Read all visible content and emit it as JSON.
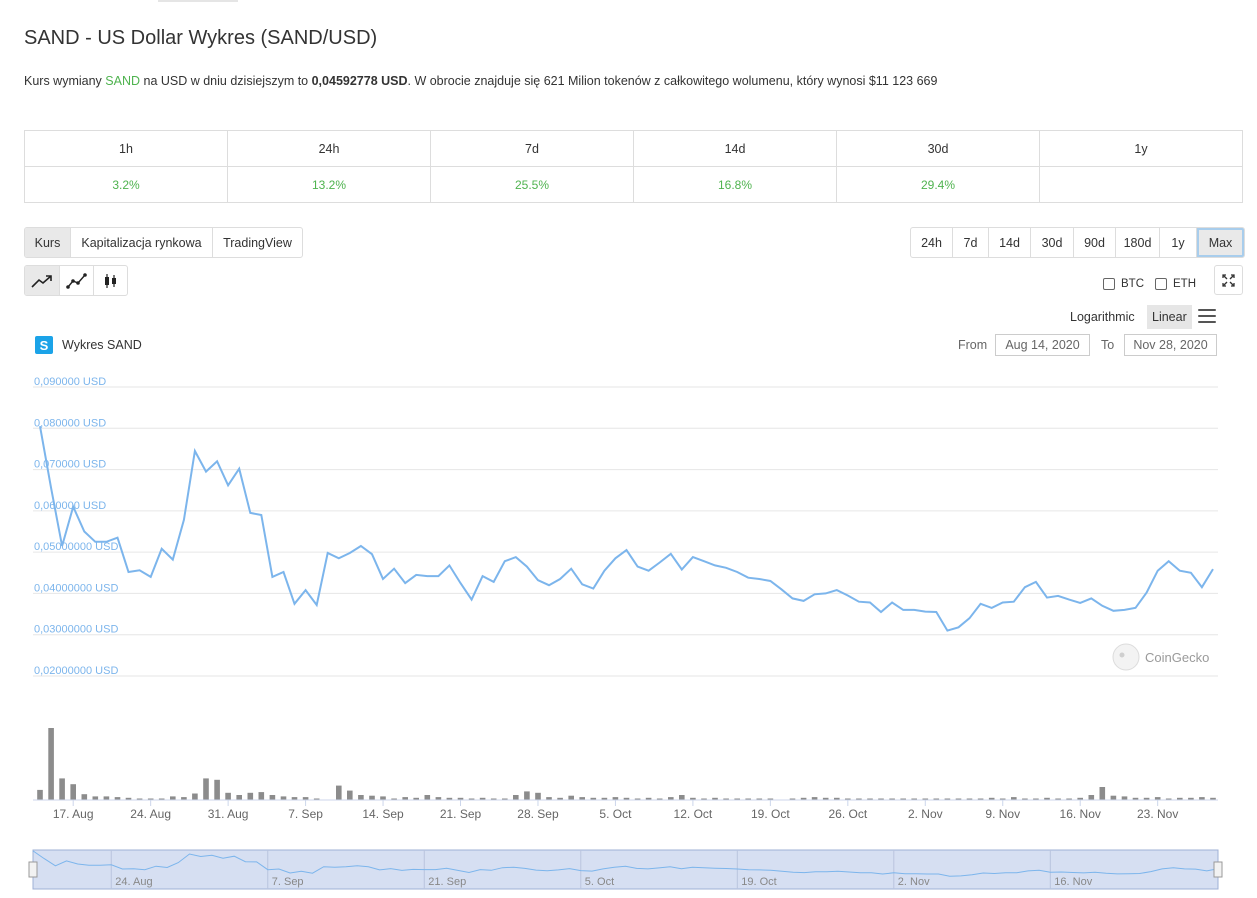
{
  "page": {
    "title": "SAND - US Dollar Wykres (SAND/USD)",
    "desc_pre": "Kurs wymiany ",
    "desc_coin": "SAND",
    "desc_mid": " na USD w dniu dzisiejszym to ",
    "desc_price": "0,04592778 USD",
    "desc_post": ". W obrocie znajduje się 621 Milion tokenów z całkowitego wolumenu, który wynosi $11 123 669"
  },
  "performance": {
    "headers": [
      "1h",
      "24h",
      "7d",
      "14d",
      "30d",
      "1y"
    ],
    "values": [
      "3.2%",
      "13.2%",
      "25.5%",
      "16.8%",
      "29.4%",
      ""
    ]
  },
  "tabs": [
    "Kurs",
    "Kapitalizacja rynkowa",
    "TradingView"
  ],
  "ranges": [
    "24h",
    "7d",
    "14d",
    "30d",
    "90d",
    "180d",
    "1y",
    "Max"
  ],
  "compare": {
    "btc": "BTC",
    "eth": "ETH"
  },
  "scale": {
    "log": "Logarithmic",
    "linear": "Linear"
  },
  "chart_label": "Wykres SAND",
  "logo_letter": "S",
  "range_from_label": "From",
  "range_from": "Aug 14, 2020",
  "range_to_label": "To",
  "range_to": "Nov 28, 2020",
  "watermark": "CoinGecko",
  "colors": {
    "line": "#7cb5ec",
    "volume": "#8c8c8c",
    "green": "#4fb34f",
    "navigator": "#d6dff2"
  },
  "chart_data": {
    "type": "line",
    "title": "",
    "ylabel": "",
    "ylim": [
      0.02,
      0.09
    ],
    "yticks": [
      0.02,
      0.03,
      0.04,
      0.05,
      0.06,
      0.07,
      0.08,
      0.09
    ],
    "ytick_labels": [
      "0,02000000 USD",
      "0,03000000 USD",
      "0,04000000 USD",
      "0,05000000 USD",
      "0,060000 USD",
      "0,070000 USD",
      "0,080000 USD",
      "0,090000 USD"
    ],
    "x_start": "2020-08-14",
    "x_end": "2020-11-28",
    "xtick_dates": [
      "2020-08-17",
      "2020-08-24",
      "2020-08-31",
      "2020-09-07",
      "2020-09-14",
      "2020-09-21",
      "2020-09-28",
      "2020-10-05",
      "2020-10-12",
      "2020-10-19",
      "2020-10-26",
      "2020-11-02",
      "2020-11-09",
      "2020-11-16",
      "2020-11-23"
    ],
    "xtick_labels": [
      "17. Aug",
      "24. Aug",
      "31. Aug",
      "7. Sep",
      "14. Sep",
      "21. Sep",
      "28. Sep",
      "5. Oct",
      "12. Oct",
      "19. Oct",
      "26. Oct",
      "2. Nov",
      "9. Nov",
      "16. Nov",
      "23. Nov"
    ],
    "navigator_labels": [
      "24. Aug",
      "7. Sep",
      "21. Sep",
      "5. Oct",
      "19. Oct",
      "2. Nov",
      "16. Nov"
    ],
    "navigator_dates": [
      "2020-08-24",
      "2020-09-07",
      "2020-09-21",
      "2020-10-05",
      "2020-10-19",
      "2020-11-02",
      "2020-11-16"
    ],
    "series": [
      {
        "values": [
          0.0805,
          0.0655,
          0.0515,
          0.061,
          0.055,
          0.0525,
          0.0525,
          0.0535,
          0.0452,
          0.0456,
          0.044,
          0.0508,
          0.0482,
          0.0578,
          0.0745,
          0.0695,
          0.072,
          0.0662,
          0.0702,
          0.0595,
          0.059,
          0.044,
          0.0452,
          0.0375,
          0.0408,
          0.0372,
          0.0498,
          0.0485,
          0.0498,
          0.0515,
          0.0495,
          0.0435,
          0.046,
          0.0425,
          0.0445,
          0.0442,
          0.0442,
          0.0468,
          0.0425,
          0.0385,
          0.0442,
          0.0428,
          0.0478,
          0.0488,
          0.0465,
          0.0432,
          0.042,
          0.0435,
          0.046,
          0.0422,
          0.0412,
          0.0455,
          0.0485,
          0.0505,
          0.0465,
          0.0455,
          0.0475,
          0.0496,
          0.0458,
          0.0488,
          0.0478,
          0.0468,
          0.0462,
          0.0452,
          0.0438,
          0.0435,
          0.043,
          0.041,
          0.0388,
          0.0382,
          0.0398,
          0.04,
          0.0408,
          0.0395,
          0.038,
          0.0378,
          0.0355,
          0.0378,
          0.036,
          0.036,
          0.0356,
          0.0355,
          0.031,
          0.0318,
          0.034,
          0.0375,
          0.0365,
          0.0378,
          0.038,
          0.0415,
          0.0428,
          0.039,
          0.0394,
          0.0385,
          0.0377,
          0.0388,
          0.037,
          0.0358,
          0.036,
          0.0365,
          0.0402,
          0.0455,
          0.0478,
          0.0455,
          0.045,
          0.0415,
          0.0459
        ]
      },
      {
        "volume": [
          0.14,
          1.0,
          0.3,
          0.22,
          0.08,
          0.05,
          0.05,
          0.04,
          0.03,
          0.01,
          0.02,
          0.02,
          0.05,
          0.04,
          0.09,
          0.3,
          0.28,
          0.1,
          0.07,
          0.1,
          0.11,
          0.07,
          0.05,
          0.04,
          0.04,
          0.01,
          0.0,
          0.2,
          0.13,
          0.07,
          0.06,
          0.05,
          0.01,
          0.04,
          0.03,
          0.07,
          0.04,
          0.03,
          0.03,
          0.02,
          0.03,
          0.02,
          0.01,
          0.07,
          0.12,
          0.1,
          0.04,
          0.03,
          0.06,
          0.04,
          0.03,
          0.03,
          0.04,
          0.03,
          0.02,
          0.03,
          0.02,
          0.04,
          0.07,
          0.03,
          0.02,
          0.03,
          0.02,
          0.01,
          0.01,
          0.01,
          0.01,
          0.0,
          0.01,
          0.03,
          0.04,
          0.03,
          0.03,
          0.02,
          0.02,
          0.02,
          0.02,
          0.01,
          0.02,
          0.01,
          0.02,
          0.02,
          0.01,
          0.01,
          0.01,
          0.02,
          0.03,
          0.02,
          0.04,
          0.01,
          0.02,
          0.03,
          0.01,
          0.01,
          0.03,
          0.07,
          0.18,
          0.06,
          0.05,
          0.03,
          0.03,
          0.04,
          0.02,
          0.03,
          0.03,
          0.04,
          0.03
        ]
      }
    ]
  }
}
